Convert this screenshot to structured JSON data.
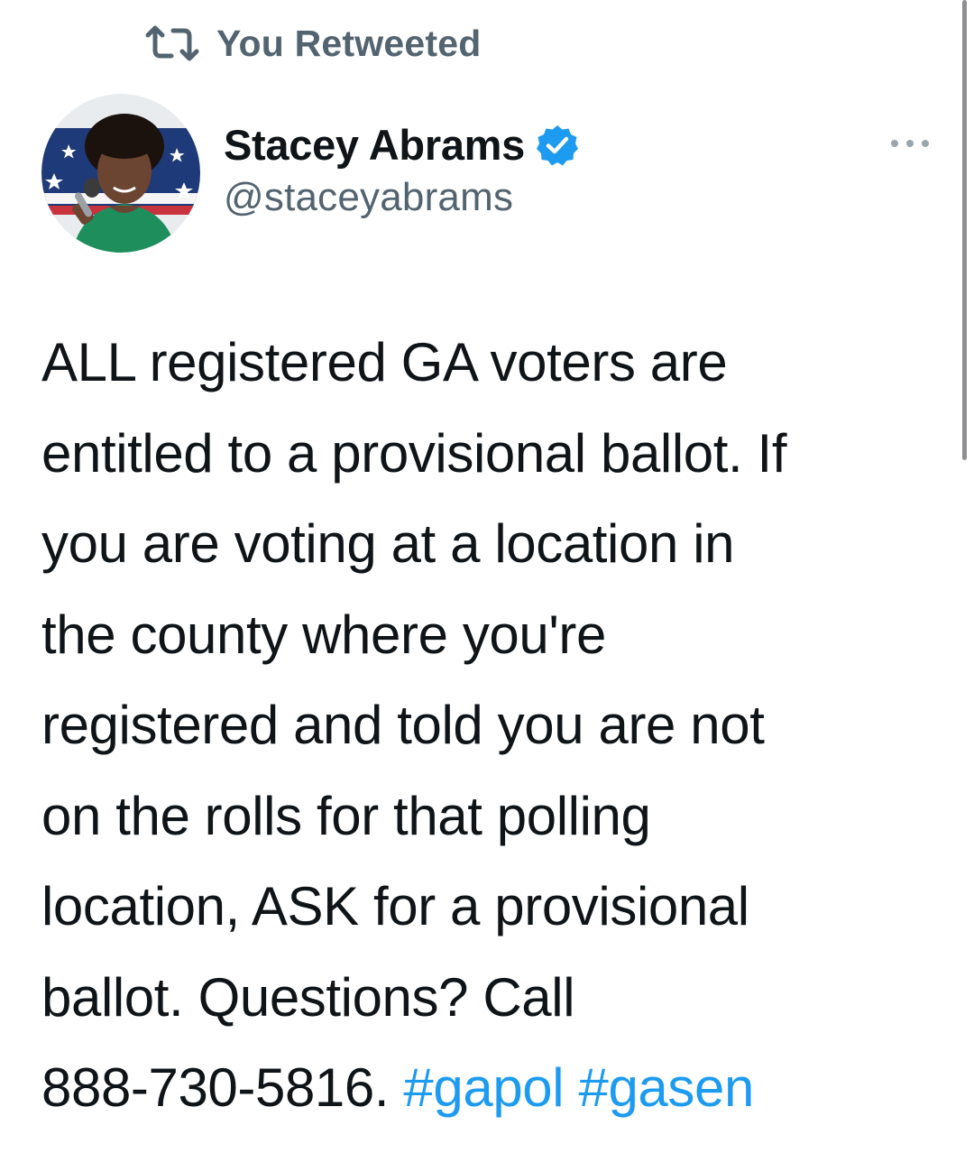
{
  "social_context": {
    "icon": "retweet-icon",
    "label": "You Retweeted",
    "color": "#536471"
  },
  "author": {
    "display_name": "Stacey Abrams",
    "handle": "@staceyabrams",
    "verified": true,
    "verified_icon": "verified-badge-icon",
    "verified_color": "#1d9bf0"
  },
  "more_menu": {
    "icon": "more-horizontal-icon"
  },
  "tweet": {
    "lines": [
      "ALL registered GA voters are",
      "entitled to a provisional ballot. If",
      "you are voting at a location in",
      "the county where you're",
      "registered and told you are not",
      "on the rolls for that polling",
      "location, ASK for a provisional",
      "ballot. Questions? Call",
      "888-730-5816."
    ],
    "hashtags": [
      "#gapol",
      "#gasen"
    ],
    "hashtag_color": "#1d9bf0"
  }
}
